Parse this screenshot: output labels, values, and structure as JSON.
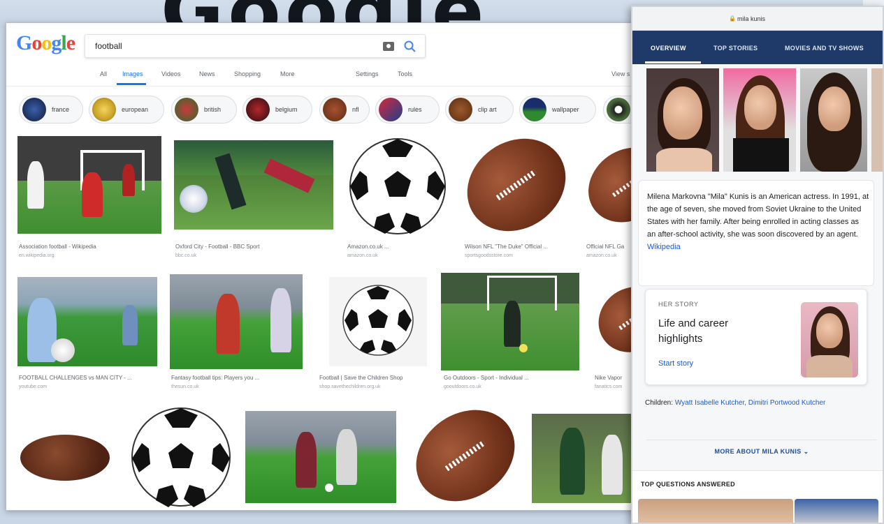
{
  "background": {
    "partial_heading": "Google"
  },
  "google": {
    "logo": "Google",
    "search_value": "football",
    "nav_tabs": [
      "All",
      "Images",
      "Videos",
      "News",
      "Shopping",
      "More"
    ],
    "settings": "Settings",
    "tools": "Tools",
    "view_saved": "View s",
    "chips": [
      "france",
      "european",
      "british",
      "belgium",
      "nfl",
      "rules",
      "clip art",
      "wallpaper"
    ],
    "results_row1": [
      {
        "caption": "Association football - Wikipedia",
        "source": "en.wikipedia.org"
      },
      {
        "caption": "Oxford City - Football - BBC Sport",
        "source": "bbc.co.uk"
      },
      {
        "caption": "Amazon.co.uk ...",
        "source": "amazon.co.uk"
      },
      {
        "caption": "Wilson NFL \"The Duke\" Official ...",
        "source": "sportsgoodsstore.com"
      },
      {
        "caption": "Official NFL Ga",
        "source": "amazon.co.uk"
      }
    ],
    "results_row2": [
      {
        "caption": "FOOTBALL CHALLENGES vs MAN CITY - ...",
        "source": "youtube.com"
      },
      {
        "caption": "Fantasy football tips: Players you ...",
        "source": "thesun.co.uk"
      },
      {
        "caption": "Football | Save the Children Shop",
        "source": "shop.savethechildren.org.uk"
      },
      {
        "caption": "Go Outdoors - Sport - Individual ...",
        "source": "gooutdoors.co.uk"
      },
      {
        "caption": "Nike Vapor",
        "source": "fanatics.com"
      }
    ]
  },
  "phone": {
    "url": "mila kunis",
    "tabs": [
      "OVERVIEW",
      "TOP STORIES",
      "MOVIES AND TV SHOWS"
    ],
    "bio": "Milena Markovna \"Mila\" Kunis is an American actress. In 1991, at the age of seven, she moved from Soviet Ukraine to the United States with her family. After being enrolled in acting classes as an after-school activity, she was soon discovered by an agent.",
    "bio_link": "Wikipedia",
    "story_kicker": "HER STORY",
    "story_title": "Life and career highlights",
    "story_cta": "Start story",
    "children_label": "Children:",
    "children_names": "Wyatt Isabelle Kutcher, Dimitri Portwood Kutcher",
    "more_link": "MORE ABOUT MILA KUNIS",
    "top_questions": "TOP QUESTIONS ANSWERED"
  },
  "colors": {
    "google_blue": "#4285F4",
    "google_red": "#EA4335",
    "google_yellow": "#FBBC05",
    "google_green": "#34A853",
    "link_blue": "#1a5bd6",
    "tab_bar": "#1f3a68"
  }
}
